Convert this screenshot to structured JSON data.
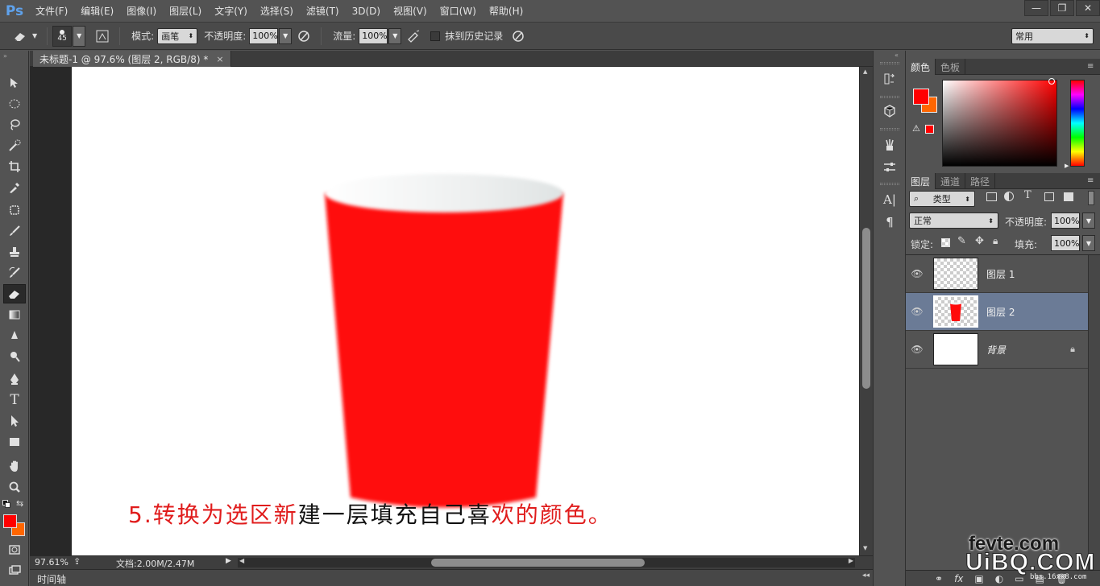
{
  "app": {
    "logo": "Ps",
    "menu": [
      "文件(F)",
      "编辑(E)",
      "图像(I)",
      "图层(L)",
      "文字(Y)",
      "选择(S)",
      "滤镜(T)",
      "3D(D)",
      "视图(V)",
      "窗口(W)",
      "帮助(H)"
    ],
    "window_controls": [
      "—",
      "❐",
      "✕"
    ]
  },
  "options": {
    "brush_size": "45",
    "mode_label": "模式:",
    "mode_value": "画笔",
    "opacity_label": "不透明度:",
    "opacity_value": "100%",
    "flow_label": "流量:",
    "flow_value": "100%",
    "history_label": "抹到历史记录",
    "workspace": "常用"
  },
  "document": {
    "tab_title": "未标题-1 @ 97.6% (图层 2, RGB/8) *",
    "tab_close": "×",
    "zoom": "97.61%",
    "doc_info": "文档:2.00M/2.47M",
    "timeline_label": "时间轴",
    "caption_red_1": "5.转换为选区新",
    "caption_black": "建一层填充自己喜",
    "caption_red_2": "欢的颜色。"
  },
  "color_panel": {
    "tabs": [
      "颜色",
      "色板"
    ],
    "foreground": "#ff0000",
    "background": "#ff6600"
  },
  "layers_panel": {
    "tabs": [
      "图层",
      "通道",
      "路径"
    ],
    "filter_kind": "类型",
    "blend_mode": "正常",
    "opacity_label": "不透明度:",
    "opacity_value": "100%",
    "lock_label": "锁定:",
    "fill_label": "填充:",
    "fill_value": "100%",
    "layers": [
      {
        "name": "图层 1",
        "selected": false
      },
      {
        "name": "图层 2",
        "selected": true
      },
      {
        "name": "背景",
        "selected": false
      }
    ],
    "footer": [
      "⚭",
      "fx",
      "▣",
      "◐",
      "▭",
      "▤",
      "🗑"
    ]
  },
  "watermark": {
    "line1": "fevte.com",
    "line2": "UiBQ.COM",
    "line3": "bbs.16xx8.com"
  },
  "colors": {
    "cup_red": "#ff0a0a",
    "selection_blue": "#6b7b96"
  }
}
